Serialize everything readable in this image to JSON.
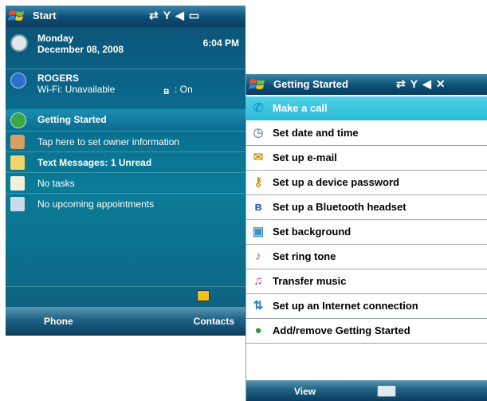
{
  "left": {
    "title": "Start",
    "date": {
      "day": "Monday",
      "date": "December 08, 2008",
      "time": "6:04 PM"
    },
    "carrier": {
      "name": "ROGERS",
      "wifi": "Wi-Fi: Unavailable",
      "bt": ": On"
    },
    "items": [
      {
        "label": "Getting Started"
      },
      {
        "label": "Tap here to set owner information"
      },
      {
        "label": "Text Messages: 1 Unread"
      },
      {
        "label": "No tasks"
      },
      {
        "label": "No upcoming appointments"
      }
    ],
    "softkeys": {
      "left": "Phone",
      "right": "Contacts"
    }
  },
  "right": {
    "title": "Getting Started",
    "items": [
      {
        "label": "Make a call",
        "icon": "phone-icon",
        "color": "#1a9ad0"
      },
      {
        "label": "Set date and time",
        "icon": "clock-icon",
        "color": "#8a9aa8"
      },
      {
        "label": "Set up e-mail",
        "icon": "email-icon",
        "color": "#d59a1a"
      },
      {
        "label": "Set up a device password",
        "icon": "key-icon",
        "color": "#d48a1a"
      },
      {
        "label": "Set up a Bluetooth headset",
        "icon": "bluetooth-icon",
        "color": "#1f55c4"
      },
      {
        "label": "Set background",
        "icon": "background-icon",
        "color": "#3f8fc9"
      },
      {
        "label": "Set ring tone",
        "icon": "ringtone-icon",
        "color": "#9a4fb8"
      },
      {
        "label": "Transfer music",
        "icon": "music-icon",
        "color": "#b035b0"
      },
      {
        "label": "Set up an Internet connection",
        "icon": "network-icon",
        "color": "#2d7fc0"
      },
      {
        "label": "Add/remove Getting Started",
        "icon": "add-remove-icon",
        "color": "#2e9c3a"
      }
    ],
    "softkeys": {
      "left": "View"
    }
  }
}
